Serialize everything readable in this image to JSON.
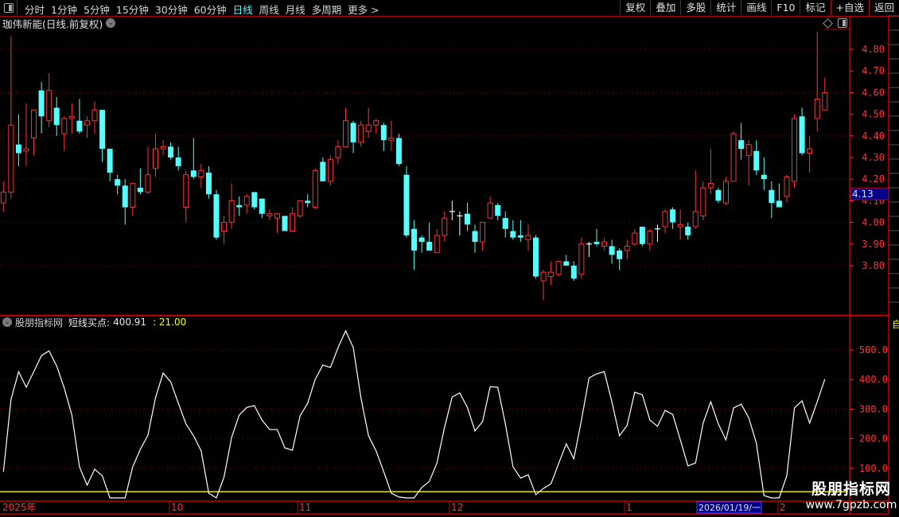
{
  "toolbar": {
    "periods": [
      "分时",
      "1分钟",
      "5分钟",
      "15分钟",
      "30分钟",
      "60分钟",
      "日线",
      "周线",
      "月线",
      "多周期",
      "更多 >"
    ],
    "active_period": "日线",
    "right_buttons": [
      "复权",
      "叠加",
      "多股",
      "统计",
      "画线",
      "F10",
      "标记",
      "+自选",
      "返回"
    ]
  },
  "chart": {
    "title": "珈伟新能(日线.前复权)",
    "price_ticks": [
      "4.80",
      "4.70",
      "4.60",
      "4.50",
      "4.40",
      "4.30",
      "4.20",
      "4.10",
      "4.00",
      "3.90",
      "3.80"
    ],
    "price_tag": "4.13",
    "colors": {
      "up": "#ff3232",
      "down": "#54ffff",
      "flat": "#ffffff",
      "axis": "#ff3333",
      "grid": "#8a0000",
      "tag_bg": "#00008b"
    }
  },
  "candles": [
    [
      4.09,
      4.19,
      4.05,
      4.14
    ],
    [
      4.14,
      4.86,
      4.11,
      4.45
    ],
    [
      4.36,
      4.5,
      4.26,
      4.32
    ],
    [
      4.33,
      4.55,
      4.26,
      4.34
    ],
    [
      4.39,
      4.52,
      4.31,
      4.52
    ],
    [
      4.61,
      4.65,
      4.41,
      4.49
    ],
    [
      4.47,
      4.69,
      4.44,
      4.61
    ],
    [
      4.53,
      4.58,
      4.4,
      4.45
    ],
    [
      4.41,
      4.49,
      4.33,
      4.48
    ],
    [
      4.48,
      4.55,
      4.41,
      4.49
    ],
    [
      4.47,
      4.57,
      4.41,
      4.42
    ],
    [
      4.45,
      4.49,
      4.39,
      4.47
    ],
    [
      4.47,
      4.56,
      4.41,
      4.52
    ],
    [
      4.52,
      4.52,
      4.28,
      4.34
    ],
    [
      4.34,
      4.34,
      4.19,
      4.23
    ],
    [
      4.2,
      4.22,
      4.13,
      4.17
    ],
    [
      4.17,
      4.2,
      3.99,
      4.07
    ],
    [
      4.07,
      4.18,
      4.03,
      4.18
    ],
    [
      4.16,
      4.25,
      4.13,
      4.14
    ],
    [
      4.14,
      4.35,
      4.13,
      4.22
    ],
    [
      4.25,
      4.41,
      4.21,
      4.34
    ],
    [
      4.34,
      4.38,
      4.31,
      4.35
    ],
    [
      4.35,
      4.37,
      4.29,
      4.3
    ],
    [
      4.3,
      4.35,
      4.24,
      4.26
    ],
    [
      4.07,
      4.24,
      4.0,
      4.22
    ],
    [
      4.24,
      4.39,
      4.2,
      4.21
    ],
    [
      4.21,
      4.27,
      4.16,
      4.24
    ],
    [
      4.23,
      4.26,
      4.11,
      4.13
    ],
    [
      4.13,
      4.15,
      3.92,
      3.93
    ],
    [
      3.96,
      4.03,
      3.9,
      4.0
    ],
    [
      4.0,
      4.18,
      3.97,
      4.1
    ],
    [
      4.08,
      4.12,
      4.03,
      4.07
    ],
    [
      4.08,
      4.13,
      4.04,
      4.12
    ],
    [
      4.14,
      4.14,
      4.06,
      4.07
    ],
    [
      4.11,
      4.11,
      4.02,
      4.04
    ],
    [
      4.03,
      4.06,
      4.01,
      4.04
    ],
    [
      4.02,
      4.04,
      3.95,
      4.04
    ],
    [
      4.03,
      4.03,
      3.96,
      3.96
    ],
    [
      3.96,
      4.07,
      3.96,
      4.04
    ],
    [
      4.03,
      4.1,
      4.02,
      4.1
    ],
    [
      4.1,
      4.13,
      4.07,
      4.09
    ],
    [
      4.07,
      4.25,
      4.06,
      4.24
    ],
    [
      4.28,
      4.3,
      4.19,
      4.19
    ],
    [
      4.19,
      4.31,
      4.17,
      4.29
    ],
    [
      4.3,
      4.38,
      4.27,
      4.35
    ],
    [
      4.35,
      4.53,
      4.35,
      4.47
    ],
    [
      4.46,
      4.47,
      4.32,
      4.37
    ],
    [
      4.37,
      4.47,
      4.35,
      4.45
    ],
    [
      4.42,
      4.53,
      4.39,
      4.45
    ],
    [
      4.45,
      4.48,
      4.41,
      4.47
    ],
    [
      4.45,
      4.46,
      4.33,
      4.38
    ],
    [
      4.38,
      4.47,
      4.33,
      4.39
    ],
    [
      4.39,
      4.41,
      4.26,
      4.27
    ],
    [
      4.22,
      4.26,
      3.93,
      3.94
    ],
    [
      3.97,
      4.01,
      3.78,
      3.87
    ],
    [
      3.93,
      3.94,
      3.86,
      3.91
    ],
    [
      3.91,
      4.0,
      3.87,
      3.87
    ],
    [
      3.86,
      3.97,
      3.86,
      3.94
    ],
    [
      3.94,
      4.05,
      3.91,
      4.02
    ],
    [
      4.05,
      4.1,
      4.01,
      4.05
    ],
    [
      4.03,
      4.05,
      3.94,
      4.03
    ],
    [
      4.04,
      4.09,
      3.96,
      3.99
    ],
    [
      3.96,
      3.99,
      3.86,
      3.91
    ],
    [
      3.91,
      4.0,
      3.87,
      4.0
    ],
    [
      4.02,
      4.12,
      4.02,
      4.09
    ],
    [
      4.08,
      4.09,
      4.01,
      4.03
    ],
    [
      4.02,
      4.05,
      3.93,
      3.97
    ],
    [
      3.96,
      4.01,
      3.92,
      3.93
    ],
    [
      3.94,
      4.01,
      3.91,
      3.93
    ],
    [
      3.92,
      3.99,
      3.87,
      3.94
    ],
    [
      3.93,
      3.94,
      3.74,
      3.75
    ],
    [
      3.73,
      3.78,
      3.64,
      3.77
    ],
    [
      3.75,
      3.82,
      3.71,
      3.77
    ],
    [
      3.76,
      3.82,
      3.75,
      3.82
    ],
    [
      3.82,
      3.85,
      3.8,
      3.8
    ],
    [
      3.8,
      3.82,
      3.73,
      3.74
    ],
    [
      3.76,
      3.93,
      3.74,
      3.9
    ],
    [
      3.9,
      3.91,
      3.84,
      3.9
    ],
    [
      3.91,
      3.97,
      3.89,
      3.9
    ],
    [
      3.89,
      3.93,
      3.87,
      3.91
    ],
    [
      3.89,
      3.92,
      3.81,
      3.85
    ],
    [
      3.87,
      3.88,
      3.78,
      3.83
    ],
    [
      3.87,
      3.92,
      3.83,
      3.89
    ],
    [
      3.9,
      3.97,
      3.89,
      3.95
    ],
    [
      3.98,
      3.98,
      3.89,
      3.9
    ],
    [
      3.9,
      3.97,
      3.87,
      3.96
    ],
    [
      3.97,
      3.99,
      3.91,
      3.97
    ],
    [
      3.98,
      4.06,
      3.95,
      4.05
    ],
    [
      4.06,
      4.07,
      3.97,
      4.0
    ],
    [
      3.98,
      4.06,
      3.92,
      3.99
    ],
    [
      3.98,
      4.0,
      3.92,
      3.94
    ],
    [
      3.98,
      4.24,
      3.97,
      4.05
    ],
    [
      4.03,
      4.19,
      4.01,
      4.16
    ],
    [
      4.16,
      4.34,
      4.13,
      4.18
    ],
    [
      4.15,
      4.16,
      4.09,
      4.1
    ],
    [
      4.09,
      4.21,
      4.08,
      4.19
    ],
    [
      4.19,
      4.42,
      4.19,
      4.41
    ],
    [
      4.38,
      4.46,
      4.29,
      4.34
    ],
    [
      4.31,
      4.38,
      4.17,
      4.36
    ],
    [
      4.33,
      4.38,
      4.22,
      4.24
    ],
    [
      4.22,
      4.3,
      4.15,
      4.2
    ],
    [
      4.15,
      4.19,
      4.02,
      4.09
    ],
    [
      4.1,
      4.18,
      4.07,
      4.07
    ],
    [
      4.12,
      4.22,
      4.09,
      4.21
    ],
    [
      4.19,
      4.5,
      4.16,
      4.48
    ],
    [
      4.49,
      4.53,
      4.31,
      4.32
    ],
    [
      4.32,
      4.4,
      4.23,
      4.34
    ],
    [
      4.48,
      4.88,
      4.42,
      4.57
    ],
    [
      4.52,
      4.67,
      4.52,
      4.6
    ]
  ],
  "indicator": {
    "source": "股朋指标网",
    "name": "短线买点:",
    "value": "400.91",
    "ref_label": ": 21.00",
    "ref_level": 21,
    "ticks": [
      "500.0",
      "400.0",
      "300.0",
      "200.0",
      "100.0"
    ],
    "line_color": "#ffffff",
    "ref_color": "#ffff00",
    "values": [
      89,
      333,
      427,
      374,
      427,
      481,
      497,
      446,
      371,
      280,
      105,
      43,
      97,
      75,
      0,
      0,
      0,
      105,
      164,
      212,
      339,
      422,
      392,
      320,
      250,
      210,
      159,
      16,
      0,
      70,
      204,
      280,
      306,
      312,
      263,
      231,
      231,
      169,
      161,
      277,
      320,
      401,
      449,
      441,
      508,
      565,
      508,
      339,
      210,
      159,
      89,
      16,
      3,
      0,
      0,
      35,
      56,
      118,
      239,
      341,
      355,
      306,
      226,
      258,
      376,
      374,
      250,
      105,
      67,
      78,
      11,
      32,
      48,
      116,
      183,
      132,
      263,
      406,
      419,
      427,
      325,
      210,
      245,
      357,
      349,
      263,
      242,
      296,
      282,
      196,
      108,
      118,
      253,
      325,
      250,
      196,
      304,
      317,
      271,
      185,
      8,
      0,
      0,
      75,
      304,
      328,
      253,
      325,
      400.91
    ]
  },
  "time_axis": {
    "labels": [
      "2025年",
      "10",
      "11",
      "12",
      "1",
      "2"
    ],
    "cursor_date": "2026/01/19/一"
  },
  "strip": {
    "tag": "自"
  },
  "watermark": {
    "line1": "股朋指标网",
    "line2": "www.7gpzb.com"
  }
}
